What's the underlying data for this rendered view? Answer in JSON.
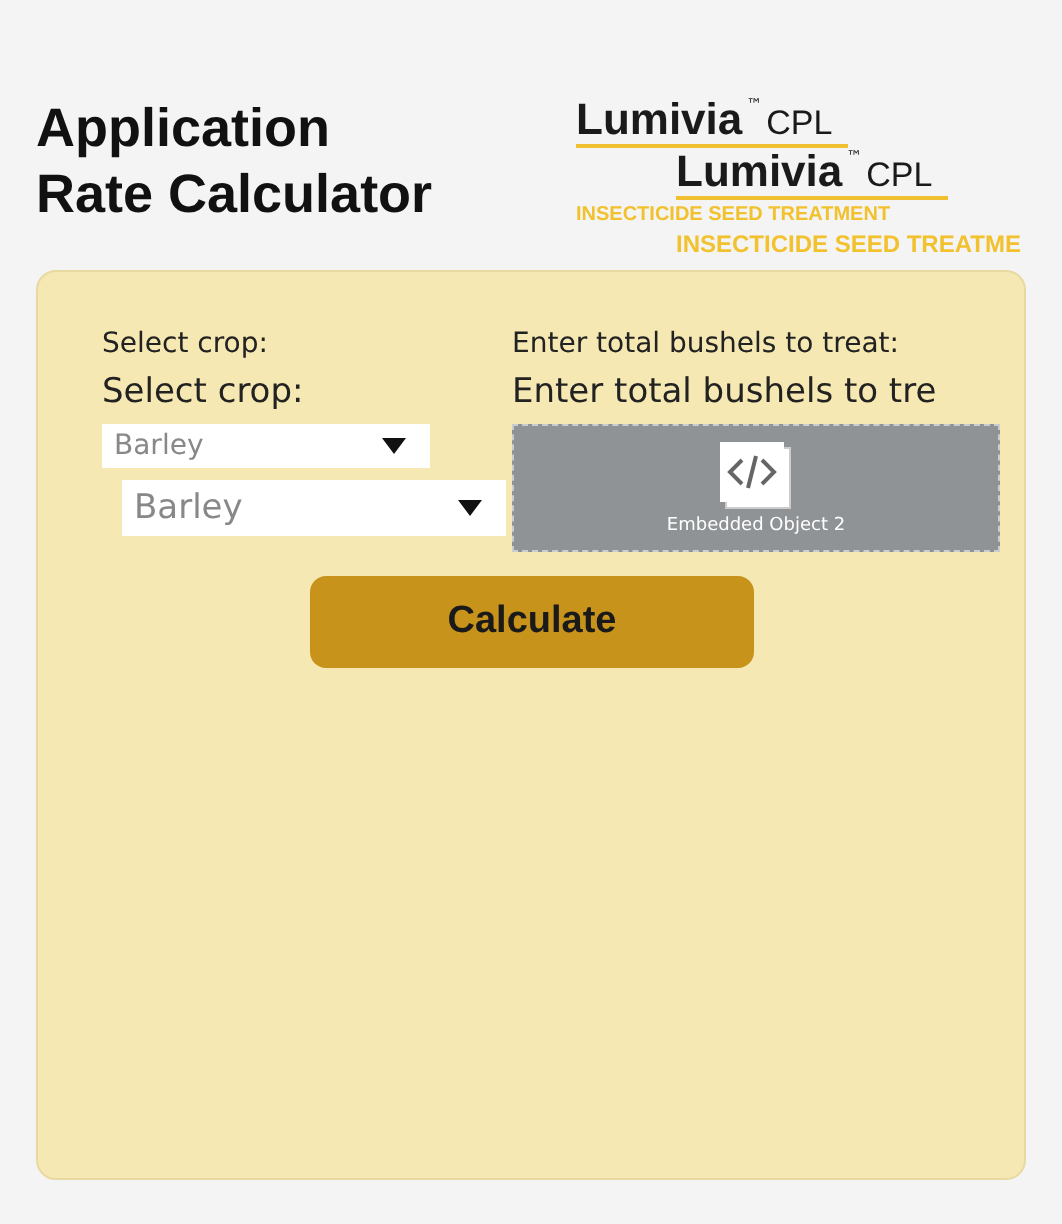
{
  "title": "Application Rate Calculator",
  "logos": [
    {
      "name": "Lumivia",
      "mark": "™",
      "suffix": "CPL",
      "tagline": "INSECTICIDE SEED TREATMENT"
    },
    {
      "name": "Lumivia",
      "mark": "™",
      "suffix": "CPL",
      "tagline": "INSECTICIDE SEED TREATME"
    }
  ],
  "crop": {
    "labels": [
      "Select crop:",
      "Select crop:"
    ],
    "selects": [
      "Barley",
      "Barley"
    ]
  },
  "bushels": {
    "labels": [
      "Enter total bushels to treat:",
      "Enter total bushels to tre"
    ],
    "embed_caption": "Embedded Object 2"
  },
  "button": "Calculate"
}
